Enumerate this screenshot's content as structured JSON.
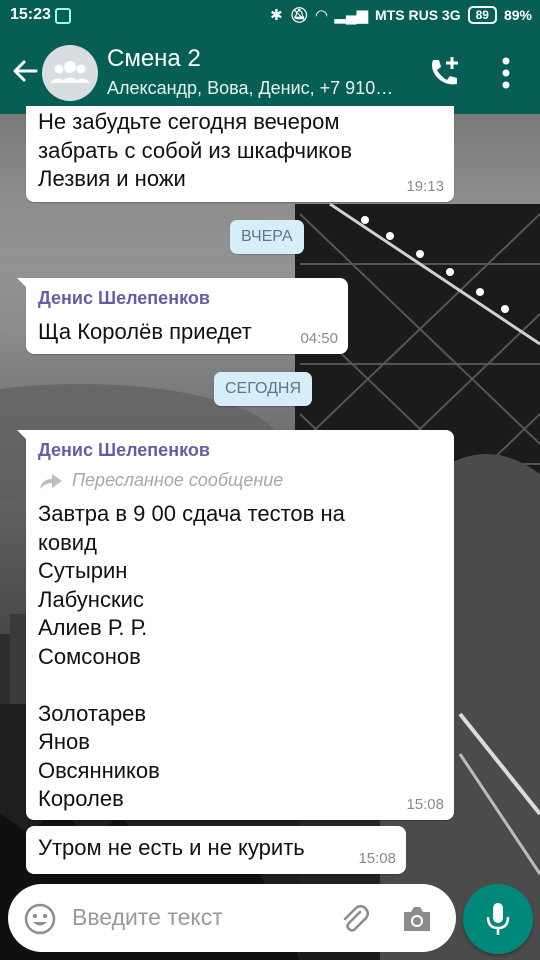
{
  "status_bar": {
    "time": "15:23",
    "carrier": "MTS RUS 3G",
    "battery_box": "89",
    "battery_pct": "89%"
  },
  "header": {
    "title": "Смена 2",
    "subtitle": "Александр, Вова, Денис, +7 910…"
  },
  "messages": [
    {
      "text": "Не забудьте сегодня вечером\nзабрать с собой из шкафчиков\nЛезвия и ножи",
      "time": "19:13"
    },
    {
      "sender": "Денис Шелепенков",
      "text": "Ща Королёв приедет",
      "time": "04:50"
    },
    {
      "sender": "Денис Шелепенков",
      "forwarded_label": "Пересланное сообщение",
      "text": "Завтра в 9 00 сдача тестов на\nковид\nСутырин\nЛабунскис\nАлиев Р. Р.\nСомсонов\n\nЗолотарев\nЯнов\nОвсянников\nКоролев",
      "time": "15:08"
    },
    {
      "text": "Утром не есть и не курить",
      "time": "15:08"
    }
  ],
  "date_chips": {
    "yesterday": "ВЧЕРА",
    "today": "СЕГОДНЯ"
  },
  "composer": {
    "placeholder": "Введите текст"
  },
  "colors": {
    "header_bg": "#075e54",
    "sender_color": "#6b5ba6",
    "date_chip_bg": "#d6eef8",
    "mic_button": "#00897b"
  }
}
